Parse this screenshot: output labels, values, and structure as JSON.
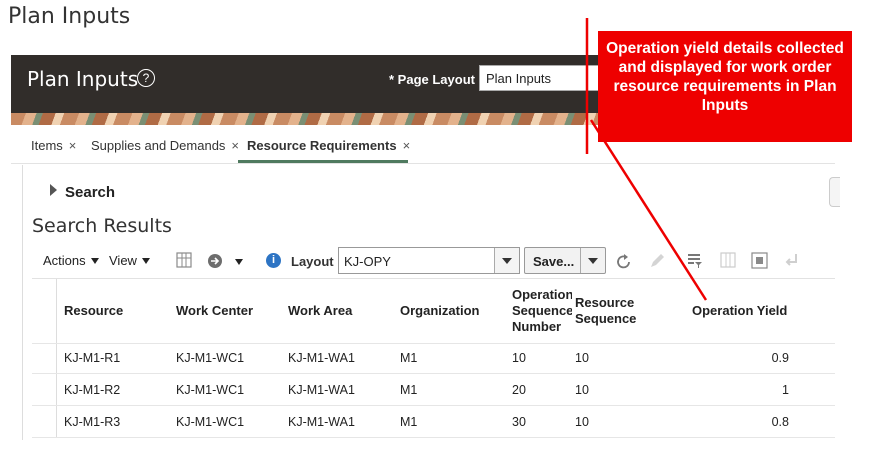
{
  "page": {
    "title": "Plan Inputs"
  },
  "header": {
    "app_title": "Plan Inputs",
    "help_glyph": "?",
    "page_layout_label": "* Page Layout",
    "page_layout_value": "Plan Inputs"
  },
  "tabs": [
    {
      "label": "Items",
      "close": "×"
    },
    {
      "label": "Supplies and Demands",
      "close": "×"
    },
    {
      "label": "Resource Requirements",
      "close": "×",
      "active": true
    }
  ],
  "search": {
    "label": "Search"
  },
  "results": {
    "title": "Search Results"
  },
  "toolbar": {
    "actions_label": "Actions",
    "view_label": "View",
    "info_glyph": "i",
    "layout_label": "Layout",
    "layout_value": "KJ-OPY",
    "save_label": "Save...",
    "icons": [
      "freeze-columns-icon",
      "go-arrow-icon",
      "refresh-icon",
      "edit-pencil-icon",
      "filter-icon",
      "columns-icon",
      "detach-icon",
      "wrap-icon"
    ]
  },
  "table": {
    "columns": {
      "resource": "Resource",
      "work_center": "Work Center",
      "work_area": "Work Area",
      "organization": "Organization",
      "op_seq_line1": "Operation",
      "op_seq_line2": "Sequence",
      "op_seq_line3": "Number",
      "res_seq_line1": "Resource",
      "res_seq_line2": "Sequence",
      "operation_yield": "Operation Yield"
    },
    "rows": [
      {
        "resource": "KJ-M1-R1",
        "work_center": "KJ-M1-WC1",
        "work_area": "KJ-M1-WA1",
        "organization": "M1",
        "op_seq": "10",
        "res_seq": "10",
        "yield": "0.9"
      },
      {
        "resource": "KJ-M1-R2",
        "work_center": "KJ-M1-WC1",
        "work_area": "KJ-M1-WA1",
        "organization": "M1",
        "op_seq": "20",
        "res_seq": "10",
        "yield": "1"
      },
      {
        "resource": "KJ-M1-R3",
        "work_center": "KJ-M1-WC1",
        "work_area": "KJ-M1-WA1",
        "organization": "M1",
        "op_seq": "30",
        "res_seq": "10",
        "yield": "0.8"
      }
    ]
  },
  "annotation": {
    "text": "Operation yield details collected and displayed for work order resource requirements in Plan Inputs",
    "color": "#ee0000"
  }
}
